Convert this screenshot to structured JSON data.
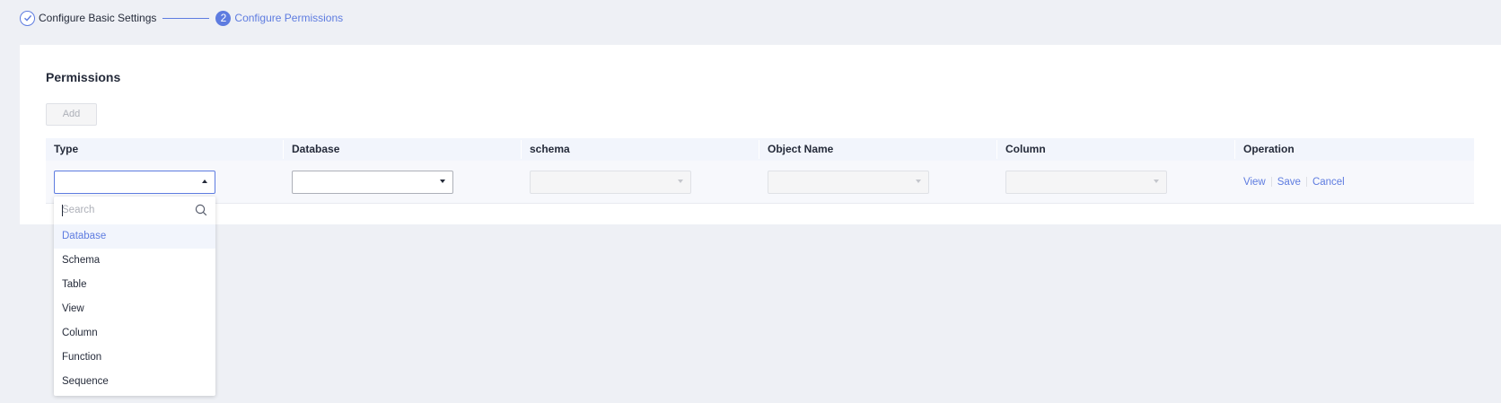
{
  "steps": [
    {
      "label": "Configure Basic Settings",
      "status": "done"
    },
    {
      "number": "2",
      "label": "Configure Permissions",
      "status": "active"
    }
  ],
  "permissions": {
    "title": "Permissions",
    "add_label": "Add",
    "columns": [
      "Type",
      "Database",
      "schema",
      "Object Name",
      "Column",
      "Operation"
    ],
    "row": {
      "type_value": "",
      "database_value": "",
      "schema_value": "",
      "object_name_value": "",
      "column_value": "",
      "operations": [
        "View",
        "Save",
        "Cancel"
      ]
    }
  },
  "dropdown": {
    "search_placeholder": "Search",
    "search_icon": "search-icon",
    "options": [
      "Database",
      "Schema",
      "Table",
      "View",
      "Column",
      "Function",
      "Sequence"
    ],
    "highlighted": "Database"
  },
  "colors": {
    "accent": "#5e7ce0",
    "background": "#eef0f5",
    "table_header": "#f2f5fc"
  }
}
